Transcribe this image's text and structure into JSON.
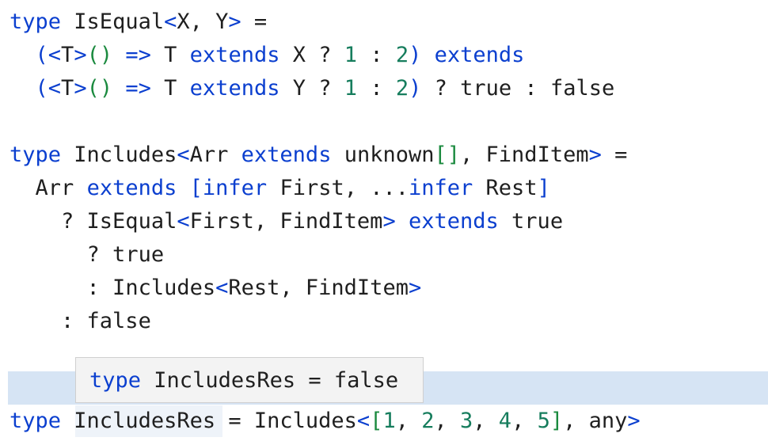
{
  "editor": {
    "keyword_type": "type",
    "l1": {
      "name": "IsEqual",
      "open": "<",
      "params": "X, Y",
      "close": ">",
      "eq": " ="
    },
    "l2": {
      "indent": "  ",
      "lp": "(",
      "tl": "<",
      "T": "T",
      "tr": ">",
      "parens": "()",
      "arrow": "=>",
      "T2": "T",
      "ext": "extends",
      "X": "X ?",
      "n1": "1",
      "colon": ":",
      "n2": "2",
      "rp": ")",
      "ext2": "extends"
    },
    "l3": {
      "indent": "  ",
      "lp": "(",
      "tl": "<",
      "T": "T",
      "tr": ">",
      "parens": "()",
      "arrow": "=>",
      "T2": "T",
      "ext": "extends",
      "Y": "Y ?",
      "n1": "1",
      "colon": ":",
      "n2": "2",
      "rp": ")",
      "rest": "? true : false"
    },
    "l4": {
      "name": "Includes",
      "open": "<",
      "arr": "Arr",
      "ext": "extends",
      "unknown": "unknown",
      "brackets": "[]",
      "comma": ", FindItem",
      "close": ">",
      "eq": " ="
    },
    "l5": {
      "indent": "  ",
      "arr": "Arr",
      "ext": "extends",
      "lb": "[",
      "infer1": "infer",
      "first": "First, ...",
      "infer2": "infer",
      "rest": "Rest",
      "rb": "]"
    },
    "l6": {
      "indent": "    ",
      "q": "? IsEqual",
      "open": "<",
      "args": "First, FindItem",
      "close": ">",
      "ext": "extends",
      "tail": "true"
    },
    "l7": {
      "indent": "      ",
      "text": "? true"
    },
    "l8": {
      "indent": "      ",
      "text": ": Includes",
      "open": "<",
      "args": "Rest, FindItem",
      "close": ">"
    },
    "l9": {
      "indent": "    ",
      "text": ": false"
    },
    "l10": {
      "name": "IncludesRes",
      "eq": " = Includes",
      "open": "<",
      "lb": "[",
      "n1": "1",
      "n2": "2",
      "n3": "3",
      "n4": "4",
      "n5": "5",
      "rb": "]",
      "any": ", any",
      "close": ">",
      "c": ", "
    }
  },
  "tooltip": {
    "keyword": "type",
    "text": "IncludesRes = false"
  },
  "colors": {
    "keyword": "#0b3fcf",
    "green": "#1b8a3f",
    "number": "#167d5d",
    "line_highlight": "#d6e4f4"
  }
}
